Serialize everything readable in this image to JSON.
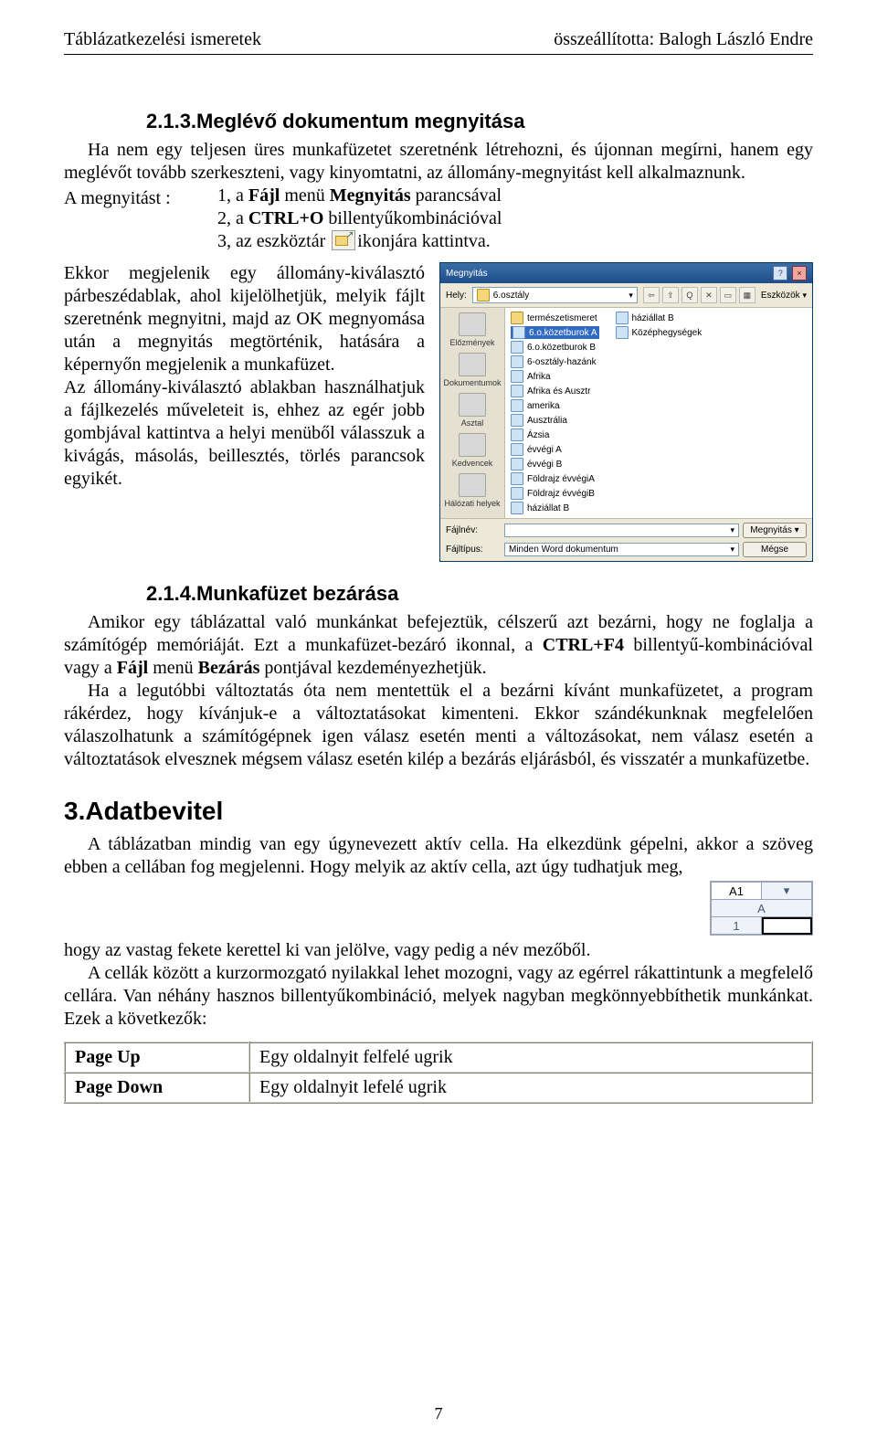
{
  "header": {
    "left": "Táblázatkezelési ismeretek",
    "right": "összeállította: Balogh László Endre"
  },
  "sec213": {
    "title": "2.1.3.Meglévő dokumentum megnyitása",
    "p1": "Ha nem egy teljesen üres munkafüzetet szeretnénk létrehozni, és újonnan megírni, hanem egy meglévőt tovább szerkeszteni, vagy kinyomtatni, az állomány-megnyitást kell alkalmaznunk.",
    "open_label": "A megnyitást :",
    "open_1_pre": "1, a ",
    "open_1_bold1": "Fájl",
    "open_1_mid": " menü ",
    "open_1_bold2": "Megnyitás",
    "open_1_post": " parancsával",
    "open_2_pre": "2, a ",
    "open_2_bold": "CTRL+O",
    "open_2_post": " billentyűkombinációval",
    "open_3_pre": "3, az eszköztár ",
    "open_3_post": "ikonjára kattintva.",
    "para_left": "Ekkor megjelenik egy állomány-kiválasztó párbeszédablak, ahol kijelölhetjük, melyik fájlt szeretnénk megnyitni, majd az OK megnyomása után a megnyitás megtörténik, hatására a képernyőn megjelenik a munkafüzet.",
    "para_left2": "Az állomány-kiválasztó ablakban használhatjuk a fájlkezelés műveleteit is, ehhez az egér jobb gombjával kattintva a helyi menüből válasszuk a kivágás, másolás, beillesztés, törlés parancsok egyikét."
  },
  "dialog": {
    "title": "Megnyitás",
    "look_in_label": "Hely:",
    "look_in_value": "6.osztály",
    "tools_label": "Eszközök",
    "places": [
      {
        "name": "Előzmények"
      },
      {
        "name": "Dokumentumok"
      },
      {
        "name": "Asztal"
      },
      {
        "name": "Kedvencek"
      },
      {
        "name": "Hálózati helyek"
      }
    ],
    "files_col1": [
      {
        "name": "természetismeret",
        "type": "folder"
      },
      {
        "name": "6.o.közetburok A",
        "type": "doc",
        "sel": true
      },
      {
        "name": "6.o.közetburok B",
        "type": "doc"
      },
      {
        "name": "6-osztály-hazánk",
        "type": "doc"
      },
      {
        "name": "Afrika",
        "type": "doc"
      },
      {
        "name": "Afrika és Ausztr",
        "type": "doc"
      },
      {
        "name": "amerika",
        "type": "doc"
      },
      {
        "name": "Ausztrália",
        "type": "doc"
      },
      {
        "name": "Ázsia",
        "type": "doc"
      },
      {
        "name": "évvégi A",
        "type": "doc"
      },
      {
        "name": "évvégi B",
        "type": "doc"
      },
      {
        "name": "Földrajz évvégiA",
        "type": "doc"
      },
      {
        "name": "Földrajz évvégiB",
        "type": "doc"
      },
      {
        "name": "háziállat B",
        "type": "doc"
      }
    ],
    "files_col2": [
      {
        "name": "háziállat B",
        "type": "doc"
      },
      {
        "name": "Középhegységek",
        "type": "doc"
      }
    ],
    "filename_label": "Fájlnév:",
    "filetype_label": "Fájltípus:",
    "filetype_value": "Minden Word dokumentum",
    "open_btn": "Megnyitás",
    "cancel_btn": "Mégse"
  },
  "sec214": {
    "title": "2.1.4.Munkafüzet bezárása",
    "p1_pre": "Amikor egy táblázattal való munkánkat befejeztük, célszerű azt bezárni, hogy ne foglalja a számítógép memóriáját. Ezt a munkafüzet-bezáró ikonnal, a ",
    "p1_b1": "CTRL+F4",
    "p1_mid": " billentyű-kombinációval vagy a ",
    "p1_b2": "Fájl",
    "p1_mid2": " menü ",
    "p1_b3": "Bezárás",
    "p1_post": " pontjával kezdeményezhetjük.",
    "p2": "Ha a legutóbbi változtatás óta nem mentettük el a bezárni kívánt munkafüzetet, a program rákérdez, hogy kívánjuk-e a változtatásokat kimenteni. Ekkor szándékunknak megfelelően válaszolhatunk a számítógépnek igen válasz esetén menti a változásokat, nem válasz esetén a változtatások elvesznek mégsem válasz esetén kilép a bezárás eljárásból, és visszatér a munkafüzetbe."
  },
  "sec3": {
    "title": "3.Adatbevitel",
    "p1": "A táblázatban mindig van egy úgynevezett aktív cella. Ha elkezdünk gépelni, akkor a szöveg ebben a cellában fog megjelenni. Hogy melyik az aktív cella, azt úgy tudhatjuk meg,",
    "p2": "hogy az vastag fekete kerettel ki van jelölve, vagy pedig a név mezőből.",
    "p3": "A cellák között a kurzormozgató nyilakkal lehet mozogni, vagy az egérrel rákattintunk a megfelelő cellára. Van néhány hasznos billentyűkombináció, melyek nagyban megkönnyebbíthetik munkánkat. Ezek a következők:"
  },
  "cellref": {
    "name": "A1",
    "col": "A",
    "row": "1"
  },
  "shortcuts": [
    {
      "key": "Page Up",
      "desc": "Egy oldalnyit felfelé ugrik"
    },
    {
      "key": "Page Down",
      "desc": "Egy oldalnyit lefelé ugrik"
    }
  ],
  "page_number": "7"
}
